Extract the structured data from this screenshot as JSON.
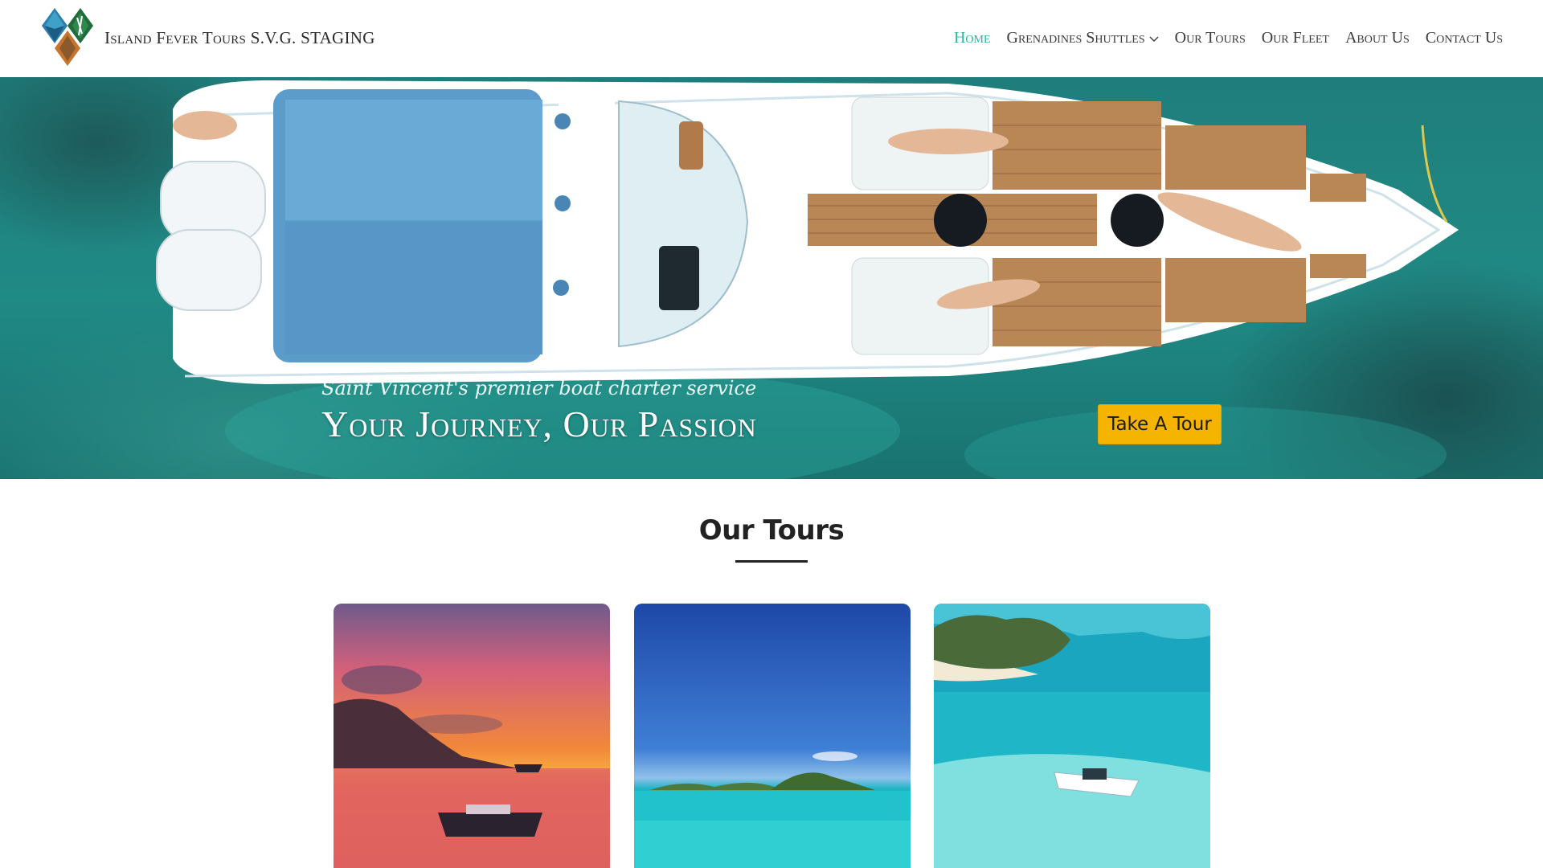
{
  "header": {
    "site_title": "Island Fever Tours S.V.G. STAGING",
    "logo_icon": "diamond-logo-icon"
  },
  "nav": {
    "items": [
      {
        "label": "Home",
        "active": true
      },
      {
        "label": "Grenadines Shuttles",
        "has_dropdown": true
      },
      {
        "label": "Our Tours"
      },
      {
        "label": "Our Fleet"
      },
      {
        "label": "About Us"
      },
      {
        "label": "Contact Us"
      }
    ],
    "active_color": "#2bb3a6"
  },
  "hero": {
    "tagline": "Saint Vincent's premier boat charter service",
    "title": "Your Journey, Our Passion",
    "cta_label": "Take A Tour",
    "cta_color": "#f5b400"
  },
  "tours": {
    "heading": "Our Tours",
    "cards": [
      {
        "image": "sunset-boat-photo"
      },
      {
        "image": "blue-sky-island-photo"
      },
      {
        "image": "aerial-boat-sandbar-photo"
      }
    ]
  }
}
